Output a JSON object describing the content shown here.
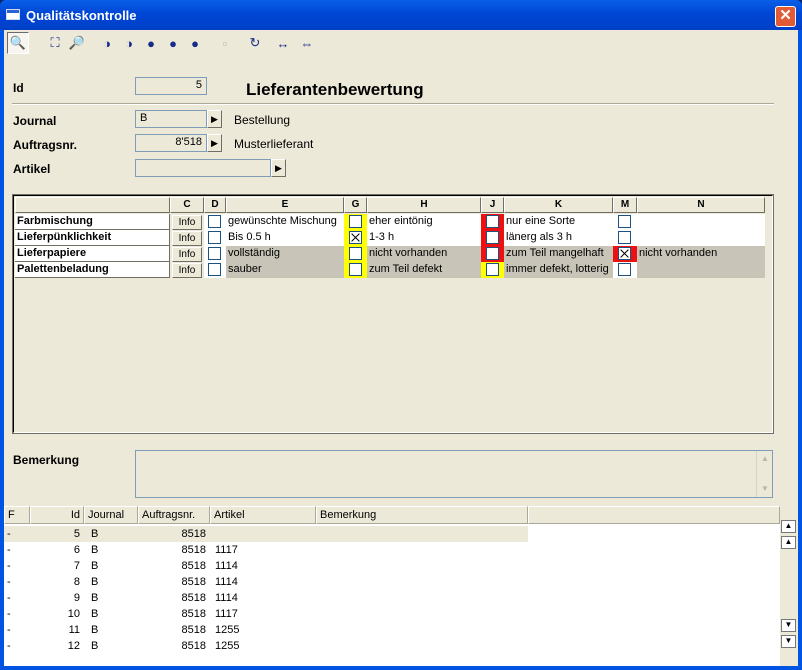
{
  "window": {
    "title": "Qualitätskontrolle",
    "close_glyph": "✕"
  },
  "toolbar": {
    "buttons": [
      {
        "name": "search-icon",
        "glyph": "🔍"
      },
      {
        "name": "binoculars-icon",
        "glyph": "⛶"
      },
      {
        "name": "find-disabled-icon",
        "glyph": "🔎"
      },
      {
        "name": "circle-half-icon",
        "glyph": "◑"
      },
      {
        "name": "circle-half-new-icon",
        "glyph": "◑"
      },
      {
        "name": "circle-full-icon",
        "glyph": "●"
      },
      {
        "name": "circle-full-new-icon",
        "glyph": "●"
      },
      {
        "name": "circle-edit-icon",
        "glyph": "●"
      },
      {
        "name": "stop-icon",
        "glyph": "▫"
      },
      {
        "name": "refresh-icon",
        "glyph": "↻"
      },
      {
        "name": "fit-width-icon",
        "glyph": "↔"
      },
      {
        "name": "fit-page-icon",
        "glyph": "⇔"
      }
    ]
  },
  "form": {
    "id_label": "Id",
    "id_value": "5",
    "heading": "Lieferantenbewertung",
    "journal_label": "Journal",
    "journal_value": "B",
    "journal_desc": "Bestellung",
    "auftrag_label": "Auftragsnr.",
    "auftrag_value": "8'518",
    "auftrag_desc": "Musterlieferant",
    "artikel_label": "Artikel",
    "artikel_value": "",
    "arrow_glyph": "▶"
  },
  "grid": {
    "headers": [
      "",
      "C",
      "D",
      "E",
      "G",
      "H",
      "J",
      "K",
      "M",
      "N"
    ],
    "info_label": "Info",
    "rows": [
      {
        "label": "Farbmischung",
        "e": "gewünschte Mischung",
        "d": false,
        "g": false,
        "h": "eher eintönig",
        "j": false,
        "k": "nur eine Sorte",
        "m": false,
        "n": ""
      },
      {
        "label": "Lieferpünklichkeit",
        "e": "Bis 0.5 h",
        "d": false,
        "g": true,
        "h": "1-3 h",
        "j": false,
        "k": "länerg als 3 h",
        "m": false,
        "n": ""
      },
      {
        "label": "Lieferpapiere",
        "e": "vollständig",
        "d": false,
        "g": false,
        "h": "nicht vorhanden",
        "j": false,
        "k": "zum Teil mangelhaft",
        "m": true,
        "n": "nicht vorhanden"
      },
      {
        "label": "Palettenbeladung",
        "e": "sauber",
        "d": false,
        "g": false,
        "h": "zum Teil defekt",
        "j": false,
        "k": "immer defekt, lotterig",
        "m": false,
        "n": ""
      }
    ],
    "colors": {
      "yellow": "#ffff00",
      "red": "#ee1111",
      "grey": "#c8c5b8"
    }
  },
  "bemerkung": {
    "label": "Bemerkung",
    "value": ""
  },
  "list": {
    "headers": [
      "F",
      "Id",
      "Journal",
      "Auftragsnr.",
      "Artikel",
      "Bemerkung"
    ],
    "rows": [
      {
        "f": "-",
        "id": "5",
        "journal": "B",
        "auftrag": "8518",
        "artikel": "",
        "bem": ""
      },
      {
        "f": "-",
        "id": "6",
        "journal": "B",
        "auftrag": "8518",
        "artikel": "1117",
        "bem": ""
      },
      {
        "f": "-",
        "id": "7",
        "journal": "B",
        "auftrag": "8518",
        "artikel": "1114",
        "bem": ""
      },
      {
        "f": "-",
        "id": "8",
        "journal": "B",
        "auftrag": "8518",
        "artikel": "1114",
        "bem": ""
      },
      {
        "f": "-",
        "id": "9",
        "journal": "B",
        "auftrag": "8518",
        "artikel": "1114",
        "bem": ""
      },
      {
        "f": "-",
        "id": "10",
        "journal": "B",
        "auftrag": "8518",
        "artikel": "1117",
        "bem": ""
      },
      {
        "f": "-",
        "id": "11",
        "journal": "B",
        "auftrag": "8518",
        "artikel": "1255",
        "bem": ""
      },
      {
        "f": "-",
        "id": "12",
        "journal": "B",
        "auftrag": "8518",
        "artikel": "1255",
        "bem": ""
      }
    ]
  }
}
